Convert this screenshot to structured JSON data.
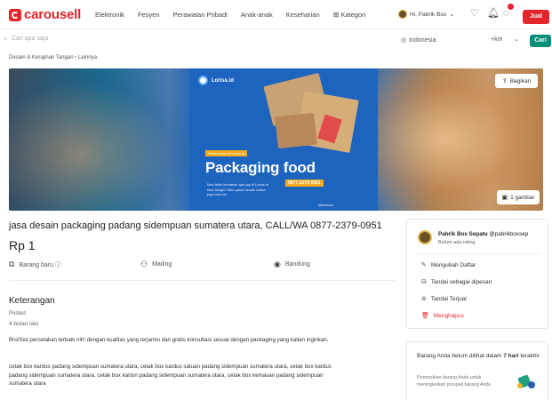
{
  "header": {
    "logo_text": "carousell",
    "nav": [
      "Elektronik",
      "Fesyen",
      "Perawatan Pribadi",
      "Anak-anak",
      "Keseharian"
    ],
    "nav_categories": "Kategori",
    "user_greeting": "Hi, Pabrik Box",
    "sell_label": "Jual",
    "brand_color": "#e4252c"
  },
  "search": {
    "placeholder": "Cari apa saja",
    "location": "Indonesia",
    "distance": "+km",
    "button_label": "Cari",
    "button_color": "#008f79"
  },
  "breadcrumb": "Desain & Kerajinan Tangan  ›  Lainnya",
  "hero": {
    "brand": "Loriss.id",
    "promo": "Semua bisa di Loriss.id",
    "headline": "Packaging food",
    "phone": "0877-2379-0951",
    "small_text": "Mau bikin kemasan apa aja di Loriss.id bisa banget. Mau pakai desain kalian juga bisa loh",
    "handle": "@lorissid",
    "share_label": "Bagikan",
    "photo_count": "1 gambar"
  },
  "listing": {
    "title": "jasa desain packaging padang sidempuan sumatera utara, CALL/WA 0877-2379-0951",
    "price": "Rp 1",
    "condition": "Barang baru ⓘ",
    "shipping": "Mailing",
    "city": "Bandung",
    "description_title": "Keterangan",
    "posted_label": "Posted",
    "posted_value": "4 bulan lalu",
    "desc_1": "Bro/Sist percetakan terbaik nih! dengan kualitas yang terjamin dan gratis konsultasi sesuai dengan packaging yang kalian inginkan.",
    "desc_2": "cetak box kardus padang sidempuan sumatera utara, cetak box kardus satuan padang sidempuan sumatera utara, cetak box kardus padang sidempuan sumatera utara, cetak box karton padang sidempuan sumatera utara, cetak box kemasan padang sidempuan sumatera utara"
  },
  "seller": {
    "name": "Pabrik Box Sepatu",
    "handle": "@pabrikboxsep",
    "rating": "Belum ada rating",
    "actions": [
      "Mengubah Daftar",
      "Tandai sebagai dipesan",
      "Tandai Terjual",
      "Menghapus"
    ]
  },
  "promo_card": {
    "head_prefix": "Barang Anda belum dilihat dalam ",
    "head_bold": "7 hari",
    "head_suffix": " terakhir",
    "sub": "Promosikan barang Anda untuk meningkatkan prospek barang Anda"
  }
}
